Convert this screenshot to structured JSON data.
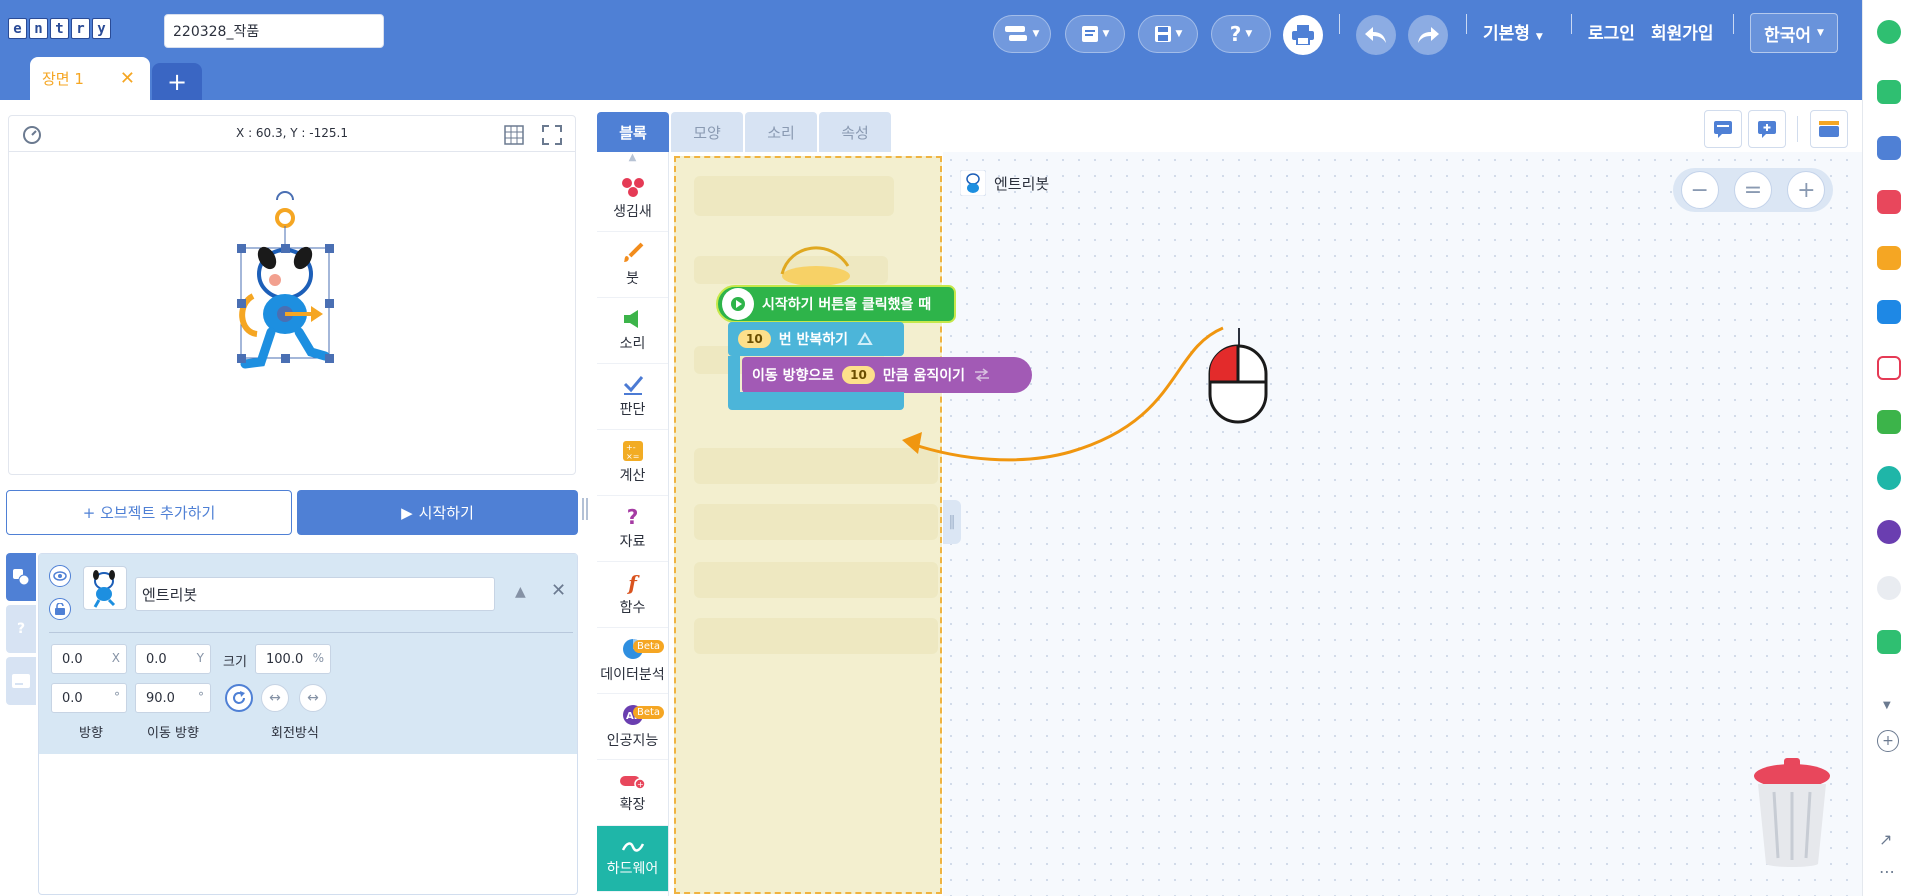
{
  "header": {
    "logo_letters": [
      "e",
      "n",
      "t",
      "r",
      "y"
    ],
    "project_title": "220328_작품",
    "scene_tab": "장면 1",
    "scene_close": "✕",
    "add_scene": "+",
    "mode": "기본형",
    "login": "로그인",
    "signup": "회원가입",
    "language": "한국어",
    "help": "?"
  },
  "stage": {
    "coords": "X : 60.3, Y : -125.1"
  },
  "buttons": {
    "add_object": "+ 오브젝트 추가하기",
    "start_icon": "▶",
    "start": "시작하기"
  },
  "object": {
    "name": "엔트리봇",
    "x": "0.0",
    "x_unit": "X",
    "y": "0.0",
    "y_unit": "Y",
    "size_label": "크기",
    "size": "100.0",
    "size_unit": "%",
    "direction": "0.0",
    "move_direction": "90.0",
    "deg": "°",
    "direction_label": "방향",
    "move_direction_label": "이동 방향",
    "rotation_label": "회전방식"
  },
  "editor_tabs": [
    "블록",
    "모양",
    "소리",
    "속성"
  ],
  "categories": [
    {
      "label": "생김새",
      "color": "#e53a55"
    },
    {
      "label": "붓",
      "color": "#f28c1c"
    },
    {
      "label": "소리",
      "color": "#3cb44a"
    },
    {
      "label": "판단",
      "color": "#4c7bd4"
    },
    {
      "label": "계산",
      "color": "#f2ac24"
    },
    {
      "label": "자료",
      "color": "#a53ba3"
    },
    {
      "label": "함수",
      "color": "#d9531e"
    },
    {
      "label": "데이터분석",
      "color": "#2f8fe0",
      "badge": "Beta"
    },
    {
      "label": "인공지능",
      "color": "#6a3eb0",
      "badge": "Beta"
    },
    {
      "label": "확장",
      "color": "#e8475c"
    },
    {
      "label": "하드웨어",
      "color": "#ffffff"
    }
  ],
  "blocks": {
    "start": "시작하기 버튼을 클릭했을 때",
    "repeat_num": "10",
    "repeat": "번 반복하기",
    "move_prefix": "이동 방향으로",
    "move_num": "10",
    "move_suffix": "만큼 움직이기"
  },
  "workspace": {
    "object_label": "엔트리봇"
  },
  "zoom": [
    "−",
    "=",
    "+"
  ],
  "colors": {
    "header": "#4f80d5",
    "start_block": "#2eb44a",
    "loop_block": "#4cb5d9",
    "move_block": "#a25ab5",
    "arrow": "#f0960f"
  }
}
